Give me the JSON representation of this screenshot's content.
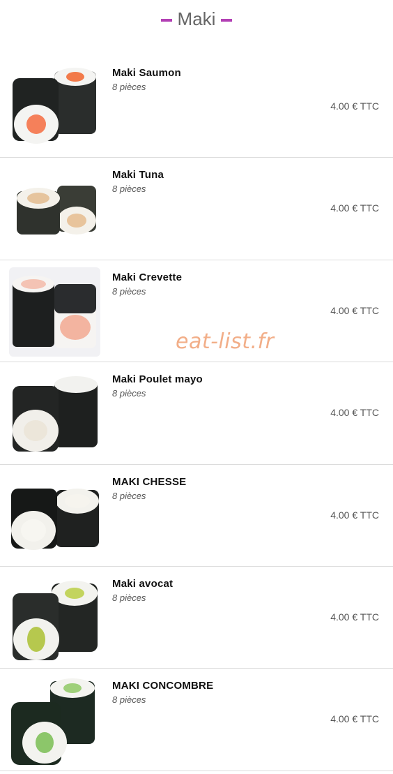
{
  "section": {
    "title": "Maki",
    "accent_color": "#b23fb4"
  },
  "watermark": "eat-list.fr",
  "items": [
    {
      "name": "Maki Saumon",
      "desc": "8 pièces",
      "price": "4.00 € TTC",
      "image": "maki-saumon-image"
    },
    {
      "name": "Maki Tuna",
      "desc": "8 pièces",
      "price": "4.00 € TTC",
      "image": "maki-tuna-image"
    },
    {
      "name": "Maki Crevette",
      "desc": "8 pièces",
      "price": "4.00 € TTC",
      "image": "maki-crevette-image"
    },
    {
      "name": "Maki Poulet mayo",
      "desc": "8 pièces",
      "price": "4.00 € TTC",
      "image": "maki-poulet-image"
    },
    {
      "name": "MAKI CHESSE",
      "desc": "8 pièces",
      "price": "4.00 € TTC",
      "image": "maki-cheese-image"
    },
    {
      "name": "Maki avocat",
      "desc": "8 pièces",
      "price": "4.00 € TTC",
      "image": "maki-avocat-image"
    },
    {
      "name": "MAKI CONCOMBRE",
      "desc": "8 pièces",
      "price": "4.00 € TTC",
      "image": "maki-concombre-image"
    }
  ]
}
